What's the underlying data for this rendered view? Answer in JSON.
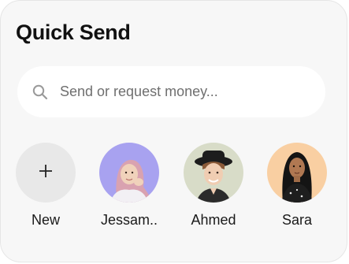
{
  "widget": {
    "title": "Quick Send"
  },
  "search": {
    "placeholder": "Send or request money...",
    "icon": "search-icon"
  },
  "contacts": [
    {
      "label": "New",
      "icon": "plus-icon",
      "color": "#e8e8e8"
    },
    {
      "label": "Jessam..",
      "color": "#a8a2f0"
    },
    {
      "label": "Ahmed",
      "color": "#d8dcc8"
    },
    {
      "label": "Sara",
      "color": "#f9cfa2"
    }
  ]
}
